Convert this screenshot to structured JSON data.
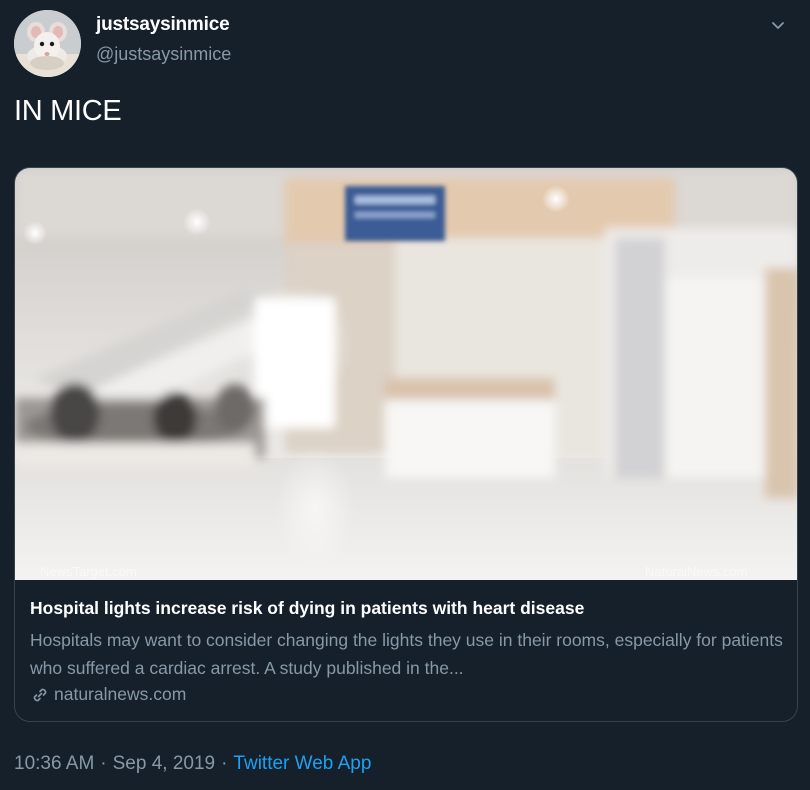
{
  "author": {
    "display_name": "justsaysinmice",
    "handle": "@justsaysinmice",
    "avatar_icon": "mouse-avatar-icon"
  },
  "tweet": {
    "text": "IN MICE"
  },
  "card": {
    "image_icon": "hospital-lobby-photo",
    "watermark_left": "NewsTarget.com",
    "watermark_right": "NaturalNews.com",
    "title": "Hospital lights increase risk of dying in patients with heart disease",
    "description": "Hospitals may want to consider changing the lights they use in their rooms, especially for patients who suffered a cardiac arrest. A study published in the...",
    "domain": "naturalnews.com",
    "domain_icon": "link-icon"
  },
  "meta": {
    "time": "10:36 AM",
    "date": "Sep 4, 2019",
    "separator": "·",
    "source": "Twitter Web App"
  },
  "colors": {
    "background": "#15202b",
    "secondary_text": "#8899a6",
    "accent": "#1da1f2",
    "border": "#38444d"
  },
  "menu_icon": "chevron-down-icon"
}
